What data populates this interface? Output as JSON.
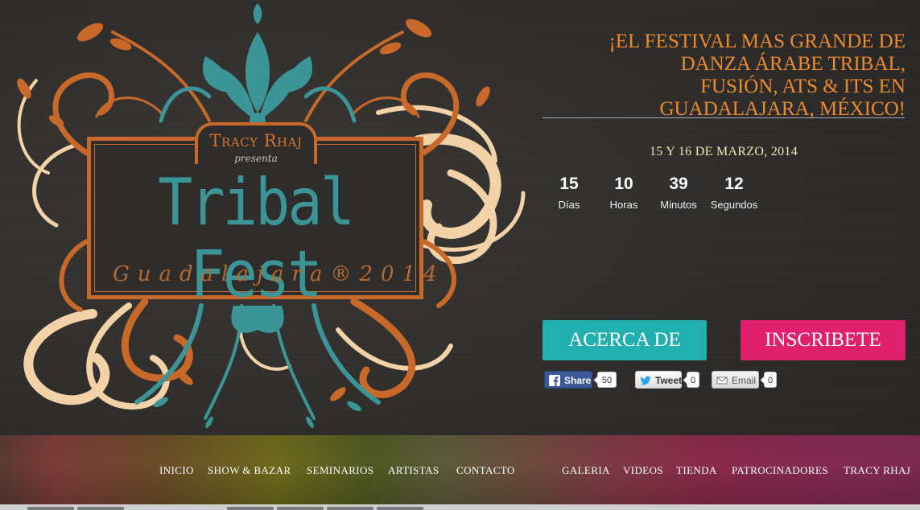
{
  "colors": {
    "orange": "#c8692a",
    "teal": "#3b9596",
    "cream": "#f3d2a8",
    "tagline": "#ec8a2e",
    "about_button": "#21b0ad",
    "signup_button": "#e0206c"
  },
  "logo": {
    "presenter": "Tracy Rhaj",
    "presenta": "presenta",
    "title": "Tribal Fest",
    "city": "Guadalajara®2014"
  },
  "tagline": {
    "lines": [
      "¡EL FESTIVAL MAS GRANDE DE",
      "DANZA ÁRABE TRIBAL,",
      "FUSIÓN, ATS & ITS EN",
      "GUADALAJARA, MÉXICO!"
    ]
  },
  "event_date": "15 Y 16 DE MARZO, 2014",
  "countdown": [
    {
      "value": "15",
      "label": "Días"
    },
    {
      "value": "10",
      "label": "Horas"
    },
    {
      "value": "39",
      "label": "Minutos"
    },
    {
      "value": "12",
      "label": "Segundos"
    }
  ],
  "buttons": {
    "about": "ACERCA DE",
    "signup": "INSCRIBETE"
  },
  "share": {
    "facebook": {
      "label": "Share",
      "count": "50",
      "icon": "facebook-icon"
    },
    "twitter": {
      "label": "Tweet",
      "count": "0",
      "icon": "twitter-icon"
    },
    "email": {
      "label": "Email",
      "count": "0",
      "icon": "email-icon"
    }
  },
  "nav": {
    "left": [
      "INICIO",
      "SHOW & BAZAR",
      "SEMINARIOS",
      "ARTISTAS",
      "CONTACTO"
    ],
    "right": [
      "GALERIA",
      "VIDEOS",
      "TIENDA",
      "PATROCINADORES",
      "TRACY RHAJ"
    ]
  }
}
